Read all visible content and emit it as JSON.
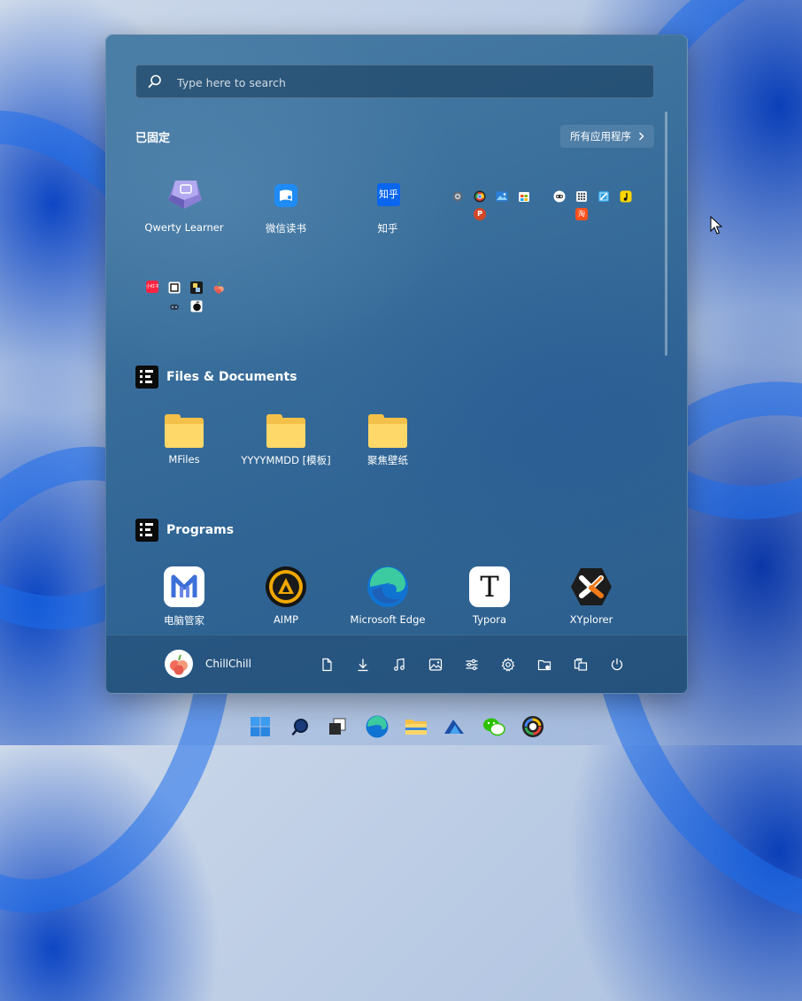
{
  "search": {
    "placeholder": "Type here to search"
  },
  "pinned": {
    "title": "已固定",
    "all_apps_label": "所有应用程序",
    "apps": [
      {
        "label": "Qwerty Learner",
        "icon": "keyboard-key-icon"
      },
      {
        "label": "微信读书",
        "icon": "weread-icon"
      },
      {
        "label": "知乎",
        "icon": "zhihu-icon",
        "icon_text": "知乎"
      }
    ],
    "group1_icons": [
      "settings-gear-icon",
      "chrome-icon",
      "photos-icon",
      "store-icon",
      "powerpoint-icon"
    ],
    "group2_icons": [
      "teams-icon",
      "calculator-icon",
      "snipping-icon",
      "music-icon",
      "taobao-icon"
    ],
    "group3_icons": [
      "netease-icon",
      "notion-icon",
      "shader-icon",
      "fruit-icon",
      "game-icon",
      "dark-app-icon"
    ],
    "group3_label_text": "小红书",
    "ppt_letter": "P",
    "taobao_letter": "淘"
  },
  "files_section": {
    "title": "Files & Documents",
    "items": [
      {
        "label": "MFiles"
      },
      {
        "label": "YYYYMMDD [模板]"
      },
      {
        "label": "聚焦壁纸"
      }
    ]
  },
  "programs_section": {
    "title": "Programs",
    "items": [
      {
        "label": "电脑管家",
        "icon": "pc-manager-icon"
      },
      {
        "label": "AIMP",
        "icon": "aimp-icon"
      },
      {
        "label": "Microsoft Edge",
        "icon": "edge-icon"
      },
      {
        "label": "Typora",
        "icon": "typora-icon",
        "letter": "T"
      },
      {
        "label": "XYplorer",
        "icon": "xyplorer-icon"
      }
    ]
  },
  "footer": {
    "user_name": "ChillChill",
    "buttons": [
      "documents-icon",
      "downloads-icon",
      "music-icon",
      "pictures-icon",
      "personalization-icon",
      "settings-icon",
      "file-explorer-icon",
      "network-icon",
      "power-icon"
    ]
  },
  "colors": {
    "accent": "#3a6f9c",
    "folder": "#ffd86a",
    "aimp": "#f0a800",
    "xyplorer": "#f07a1a"
  }
}
